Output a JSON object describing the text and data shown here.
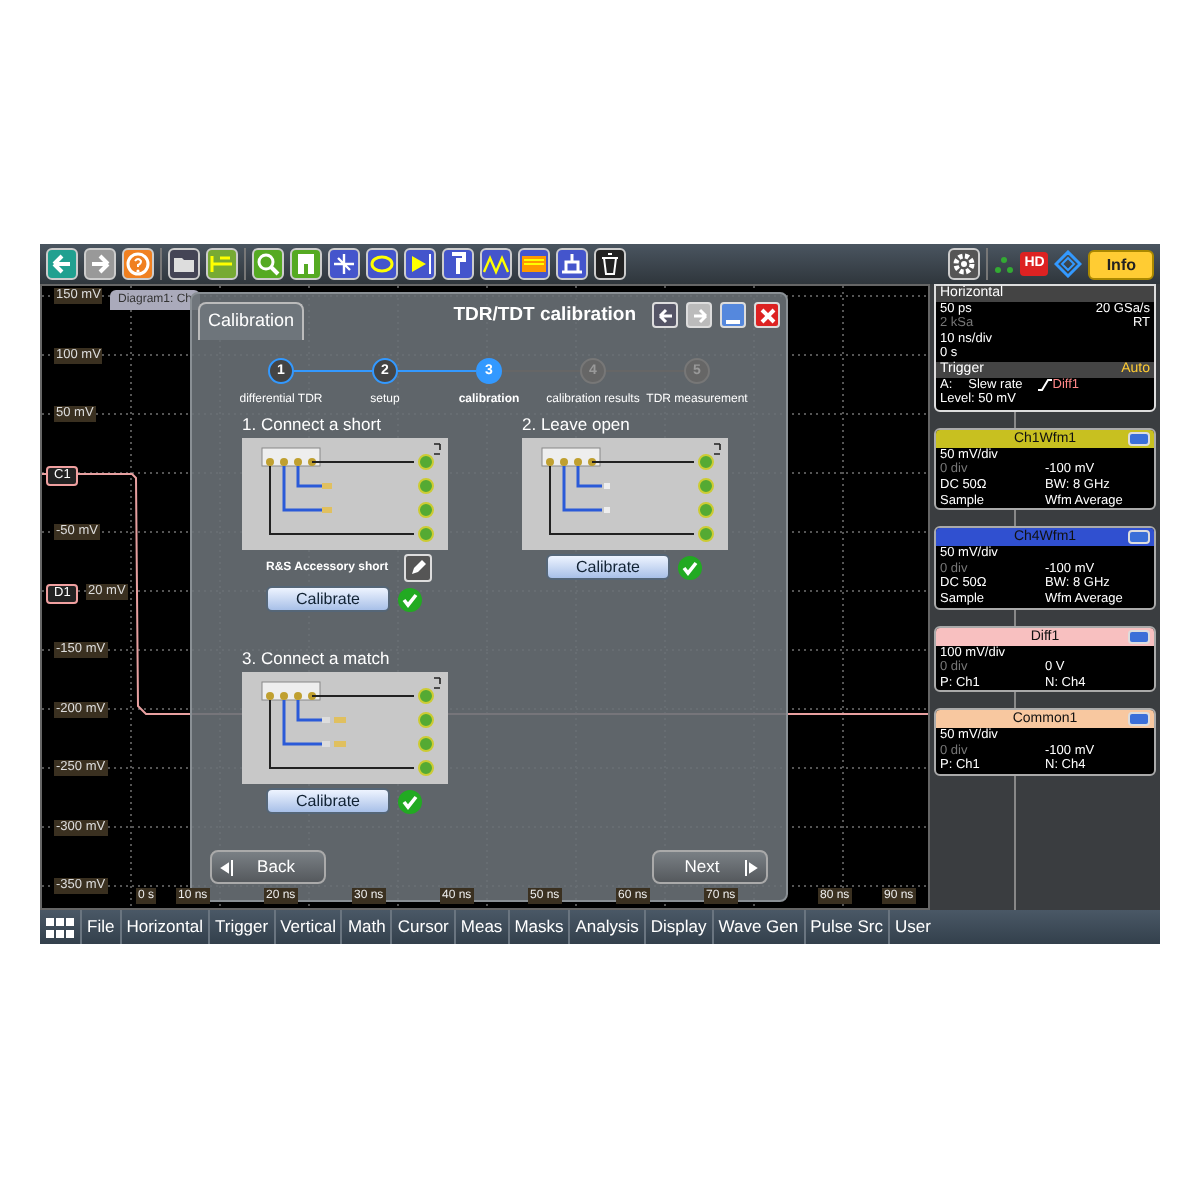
{
  "plot": {
    "tab": "Diagram1: Ch",
    "y_labels": [
      {
        "text": "150 mV"
      },
      {
        "text": "100 mV"
      },
      {
        "text": "50 mV"
      },
      {
        "marker": "C1"
      },
      {
        "text": "-50 mV"
      },
      {
        "marker": "D1",
        "text": "20 mV"
      },
      {
        "text": "-150 mV"
      },
      {
        "text": "-200 mV"
      },
      {
        "text": "-250 mV"
      },
      {
        "text": "-300 mV"
      },
      {
        "text": "-350 mV"
      }
    ],
    "x_labels": [
      "0 s",
      "10 ns",
      "20 ns",
      "30 ns",
      "40 ns",
      "50 ns",
      "60 ns",
      "70 ns",
      "80 ns",
      "90 ns"
    ]
  },
  "dialog": {
    "tab": "Calibration",
    "title": "TDR/TDT calibration",
    "steps": [
      {
        "number": "1",
        "label": "differential TDR",
        "completed": true,
        "selected": false
      },
      {
        "number": "2",
        "label": "setup",
        "completed": true,
        "selected": false
      },
      {
        "number": "3",
        "label": "calibration",
        "completed": false,
        "selected": true
      },
      {
        "number": "4",
        "label": "calibration results",
        "completed": false,
        "selected": false
      },
      {
        "number": "5",
        "label": "TDR measurement",
        "completed": false,
        "selected": false
      }
    ],
    "sections": [
      {
        "title": "1. Connect a short",
        "kind": "short",
        "accessory": "R&S Accessory short",
        "button": "Calibrate",
        "done": true
      },
      {
        "title": "2. Leave open",
        "kind": "open",
        "button": "Calibrate",
        "done": true
      },
      {
        "title": "3. Connect a match",
        "kind": "match",
        "button": "Calibrate",
        "done": true
      }
    ],
    "back": "Back",
    "next": "Next"
  },
  "horizontal": {
    "title": "Horizontal",
    "rows": [
      {
        "left": {
          "text": "50 ps",
          "dimmed": false
        },
        "right": {
          "text": "20 GSa/s",
          "dimmed": false
        }
      },
      {
        "left": {
          "text": "2 kSa",
          "dimmed": true
        },
        "right": {
          "text": "RT",
          "dimmed": false
        }
      },
      {
        "left": {
          "text": "10 ns/div",
          "dimmed": false
        }
      },
      {
        "left": {
          "text": "0 s",
          "dimmed": false
        }
      }
    ]
  },
  "trigger": {
    "title": "Trigger",
    "mode": "Auto",
    "event": "A:",
    "type": "Slew rate",
    "source": "Diff1",
    "level": "Level: 50 mV"
  },
  "channels": [
    {
      "name": "Ch1Wfm1",
      "color": "#c8c020",
      "rows": [
        {
          "left": {
            "text": "50 mV/div",
            "dimmed": false
          }
        },
        {
          "left": {
            "text": "0 div",
            "dimmed": true
          },
          "right": {
            "text": "-100 mV",
            "dimmed": false
          }
        },
        {
          "left": {
            "text": "DC 50Ω",
            "dimmed": false
          },
          "right": {
            "text": "BW: 8 GHz",
            "dimmed": false
          }
        },
        {
          "left": {
            "text": "Sample",
            "dimmed": false
          },
          "right": {
            "text": "Wfm Average",
            "dimmed": false
          }
        }
      ]
    },
    {
      "name": "Ch4Wfm1",
      "color": "#3050d0",
      "rows": [
        {
          "left": {
            "text": "50 mV/div",
            "dimmed": false
          }
        },
        {
          "left": {
            "text": "0 div",
            "dimmed": true
          },
          "right": {
            "text": "-100 mV",
            "dimmed": false
          }
        },
        {
          "left": {
            "text": "DC 50Ω",
            "dimmed": false
          },
          "right": {
            "text": "BW: 8 GHz",
            "dimmed": false
          }
        },
        {
          "left": {
            "text": "Sample",
            "dimmed": false
          },
          "right": {
            "text": "Wfm Average",
            "dimmed": false
          }
        }
      ]
    },
    {
      "name": "Diff1",
      "color": "#f8c0c0",
      "rows": [
        {
          "left": {
            "text": "100 mV/div",
            "dimmed": false
          }
        },
        {
          "left": {
            "text": "0 div",
            "dimmed": true
          },
          "right": {
            "text": "0 V",
            "dimmed": false
          }
        },
        {
          "left": {
            "text": "P: Ch1",
            "dimmed": false
          },
          "right": {
            "text": "N: Ch4",
            "dimmed": false
          }
        }
      ]
    },
    {
      "name": "Common1",
      "color": "#f8c8a0",
      "rows": [
        {
          "left": {
            "text": "50 mV/div",
            "dimmed": false
          }
        },
        {
          "left": {
            "text": "0 div",
            "dimmed": true
          },
          "right": {
            "text": "-100 mV",
            "dimmed": false
          }
        },
        {
          "left": {
            "text": "P: Ch1",
            "dimmed": false
          },
          "right": {
            "text": "N: Ch4",
            "dimmed": false
          }
        }
      ]
    }
  ],
  "info_button": "Info",
  "hd_badge": "HD",
  "menu": [
    "File",
    "Horizontal",
    "Trigger",
    "Vertical",
    "Math",
    "Cursor",
    "Meas",
    "Masks",
    "Analysis",
    "Display",
    "Wave Gen",
    "Pulse Src",
    "User"
  ]
}
